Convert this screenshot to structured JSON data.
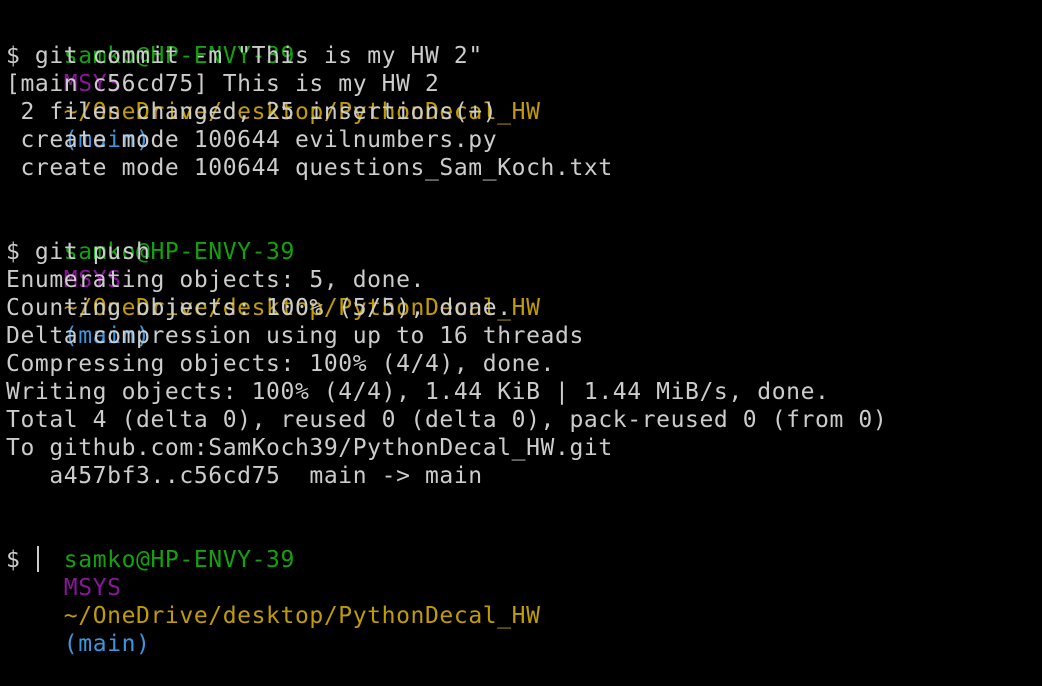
{
  "prompt": {
    "user_host": "samko@HP-ENVY-39",
    "system": "MSYS",
    "path": "~/OneDrive/desktop/PythonDecal_HW",
    "branch": "(main)",
    "symbol": "$"
  },
  "commands": {
    "commit": "git commit -m \"This is my HW 2\"",
    "push": "git push"
  },
  "commit_output": [
    "[main c56cd75] This is my HW 2",
    " 2 files changed, 25 insertions(+)",
    " create mode 100644 evilnumbers.py",
    " create mode 100644 questions_Sam_Koch.txt"
  ],
  "push_output": [
    "Enumerating objects: 5, done.",
    "Counting objects: 100% (5/5), done.",
    "Delta compression using up to 16 threads",
    "Compressing objects: 100% (4/4), done.",
    "Writing objects: 100% (4/4), 1.44 KiB | 1.44 MiB/s, done.",
    "Total 4 (delta 0), reused 0 (delta 0), pack-reused 0 (from 0)",
    "To github.com:SamKoch39/PythonDecal_HW.git",
    "   a457bf3..c56cd75  main -> main"
  ],
  "colors": {
    "background": "#000000",
    "text": "#cccccc",
    "user_host": "#13a10e",
    "system": "#881798",
    "path": "#c19c00",
    "branch": "#3a96dd"
  }
}
